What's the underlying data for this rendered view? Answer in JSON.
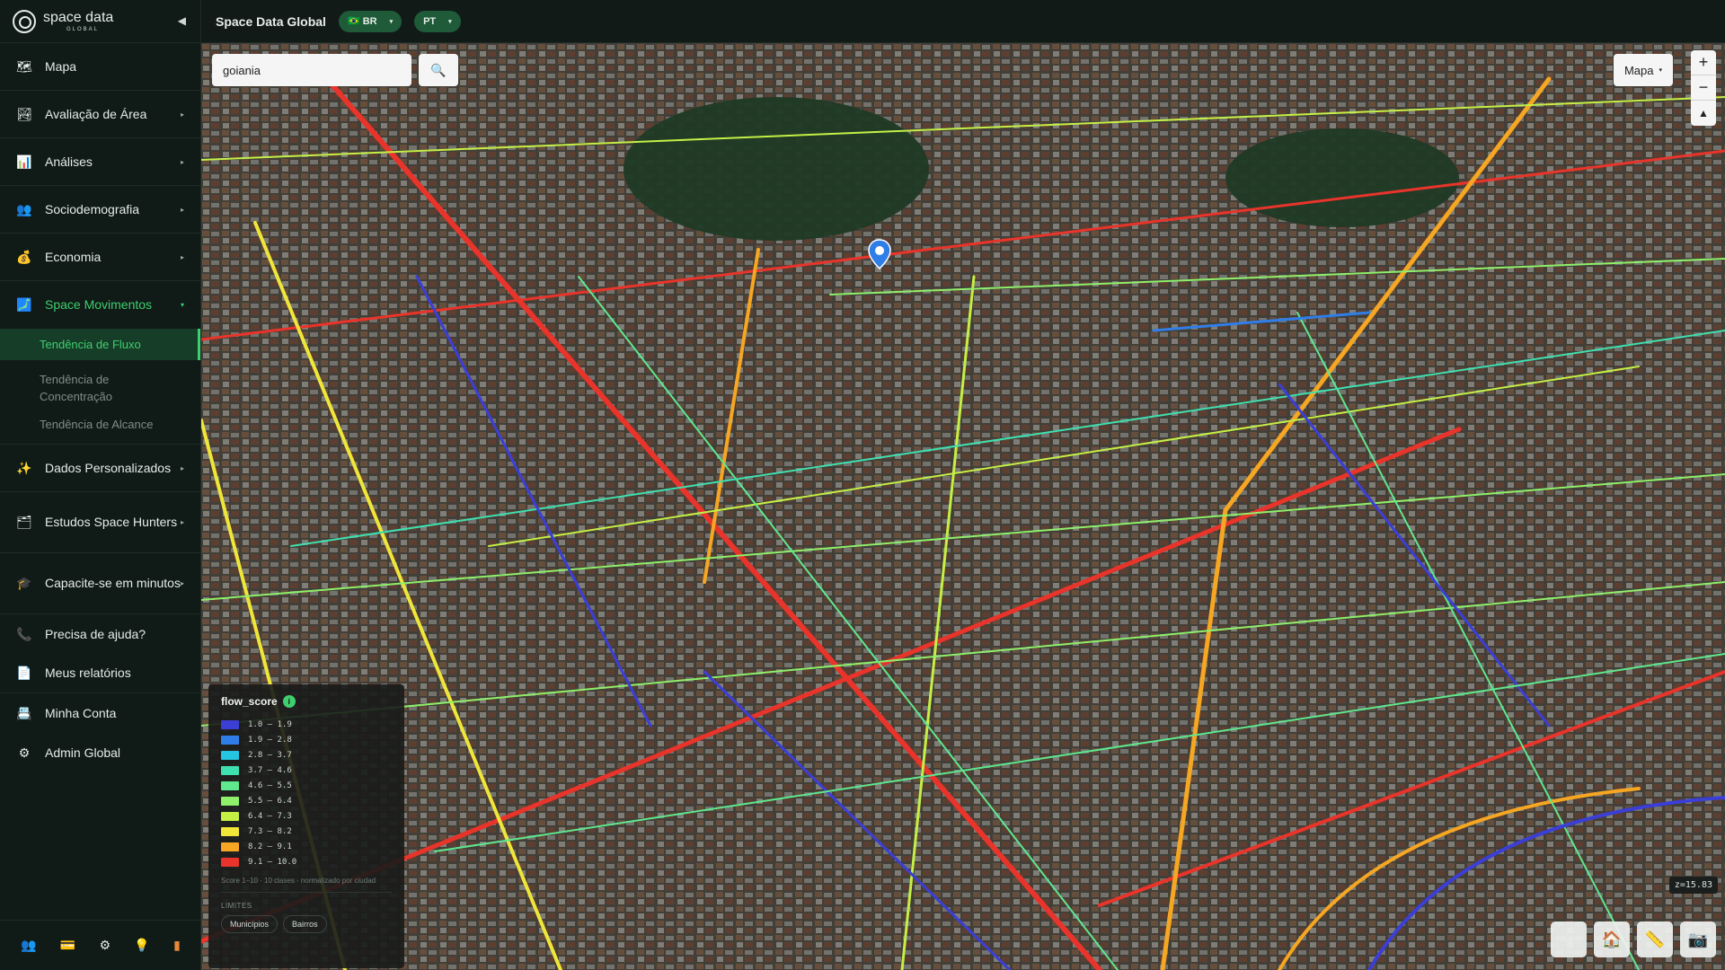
{
  "brand": {
    "name": "space data",
    "sub": "GLOBAL"
  },
  "sidebar": {
    "items": [
      {
        "label": "Mapa",
        "icon": "map-icon"
      },
      {
        "label": "Avaliação de Área",
        "icon": "area-icon"
      },
      {
        "label": "Análises",
        "icon": "chart-icon"
      },
      {
        "label": "Sociodemografia",
        "icon": "people-icon"
      },
      {
        "label": "Economia",
        "icon": "money-bag-icon"
      },
      {
        "label": "Space Movimentos",
        "icon": "movement-icon"
      },
      {
        "label": "Dados Personalizados",
        "icon": "sparkle-icon"
      },
      {
        "label": "Estudos Space Hunters",
        "icon": "studies-icon"
      },
      {
        "label": "Capacite-se em minutos",
        "icon": "graduation-icon"
      },
      {
        "label": "Precisa de ajuda?",
        "icon": "phone-icon"
      },
      {
        "label": "Meus relatórios",
        "icon": "document-icon"
      },
      {
        "label": "Minha Conta",
        "icon": "account-icon"
      },
      {
        "label": "Admin Global",
        "icon": "gear-icon"
      }
    ],
    "subitems": [
      {
        "label": "Tendência de Fluxo"
      },
      {
        "label": "Tendência de Concentração"
      },
      {
        "label": "Tendência de Alcance"
      }
    ]
  },
  "topbar": {
    "title": "Space Data Global",
    "country": "🇧🇷 BR",
    "language": "PT"
  },
  "search": {
    "value": "goiania"
  },
  "map": {
    "layer_label": "Mapa",
    "zoom_readout": "z=15.83"
  },
  "legend": {
    "title": "flow_score",
    "ranges": [
      {
        "label": "1.0 – 1.9",
        "color": "#3b3fd6"
      },
      {
        "label": "1.9 – 2.8",
        "color": "#2f7ee8"
      },
      {
        "label": "2.8 – 3.7",
        "color": "#25c4e0"
      },
      {
        "label": "3.7 – 4.6",
        "color": "#3fe0b0"
      },
      {
        "label": "4.6 – 5.5",
        "color": "#5fe88e"
      },
      {
        "label": "5.5 – 6.4",
        "color": "#8ef06a"
      },
      {
        "label": "6.4 – 7.3",
        "color": "#c4f046"
      },
      {
        "label": "7.3 – 8.2",
        "color": "#f0e63a"
      },
      {
        "label": "8.2 – 9.1",
        "color": "#f5a623"
      },
      {
        "label": "9.1 – 10.0",
        "color": "#e8342a"
      }
    ],
    "note": "Score 1–10 · 10 clases · normalizado por ciudad",
    "limits_label": "LIMITES",
    "buttons": [
      "Municípios",
      "Bairros"
    ]
  },
  "colors": {
    "accent": "#3ecf6e",
    "active_bg": "#163d28"
  }
}
